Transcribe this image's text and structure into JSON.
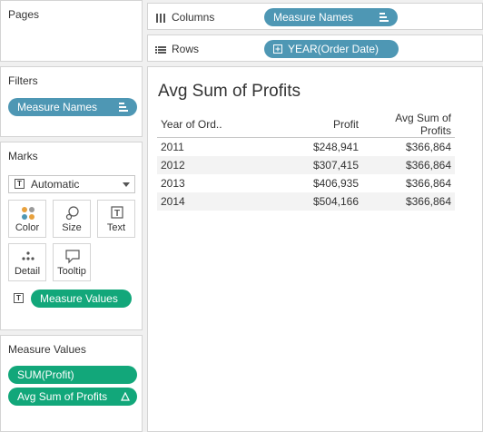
{
  "pages": {
    "title": "Pages"
  },
  "filters": {
    "title": "Filters",
    "pill": "Measure Names"
  },
  "marks": {
    "title": "Marks",
    "type_value": "Automatic",
    "buttons": [
      "Color",
      "Size",
      "Text",
      "Detail",
      "Tooltip"
    ],
    "text_pill": "Measure Values"
  },
  "measure_values": {
    "title": "Measure Values",
    "items": [
      "SUM(Profit)",
      "Avg Sum of Profits"
    ]
  },
  "columns_shelf": {
    "label": "Columns",
    "pill": "Measure Names"
  },
  "rows_shelf": {
    "label": "Rows",
    "pill": "YEAR(Order Date)"
  },
  "view": {
    "title": "Avg Sum of Profits",
    "headers": [
      "Year of Ord..",
      "Profit",
      "Avg Sum of Profits"
    ],
    "rows": [
      [
        "2011",
        "$248,941",
        "$366,864"
      ],
      [
        "2012",
        "$307,415",
        "$366,864"
      ],
      [
        "2013",
        "$406,935",
        "$366,864"
      ],
      [
        "2014",
        "$504,166",
        "$366,864"
      ]
    ]
  },
  "colors": {
    "dimension_pill": "#4e97b4",
    "measure_pill": "#12a77a"
  }
}
